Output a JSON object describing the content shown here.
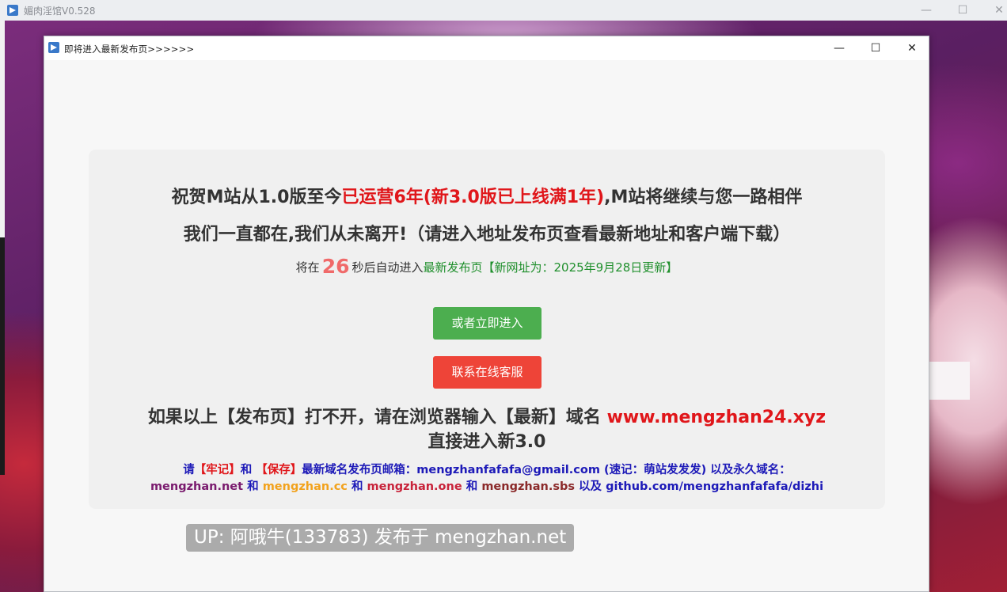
{
  "background_window": {
    "title": "媚肉淫馆V0.528",
    "minimize": "—",
    "maximize": "☐",
    "close": "✕"
  },
  "dialog": {
    "title": "即将进入最新发布页>>>>>>",
    "minimize": "—",
    "maximize": "☐",
    "close": "✕"
  },
  "content": {
    "line1_a": "祝贺M站从1.0版至今",
    "line1_b": "已运营6年(新3.0版已上线满1年)",
    "line1_c": ",M站将继续与您一路相伴",
    "line2": "我们一直都在,我们从未离开!（请进入地址发布页查看最新地址和客户端下载）",
    "line3_a": "将在",
    "countdown": "26",
    "line3_b": "秒后自动进入",
    "line3_c": "最新发布页【新网址为：2025年9月28日更新】",
    "enter_button": "或者立即进入",
    "service_button": "联系在线客服",
    "warn_a": "如果以上【发布页】打不开，请在浏览器输入【最新】域名",
    "warn_domain": "www.mengzhan24.xyz",
    "warn_b": "直接进入新3.0",
    "note_a": "请",
    "note_b": "【牢记】",
    "note_c": "和",
    "note_d": "【保存】",
    "note_e": "最新域名发布页邮箱：mengzhanfafafa@gmail.com (速记：萌站发发发) 以及永久域名：",
    "domain1": "mengzhan.net",
    "and1": "和",
    "domain2": "mengzhan.cc",
    "and2": "和",
    "domain3": "mengzhan.one",
    "and3": "和",
    "domain4": "mengzhan.sbs",
    "and4": "以及",
    "domain5": "github.com/mengzhanfafafa/dizhi"
  },
  "watermark": "UP: 阿哦牛(133783) 发布于 mengzhan.net",
  "colors": {
    "accent_red": "#e0161a",
    "button_green": "#4cae4f",
    "button_red": "#ee4438",
    "link_blue": "#1d1ab8"
  }
}
